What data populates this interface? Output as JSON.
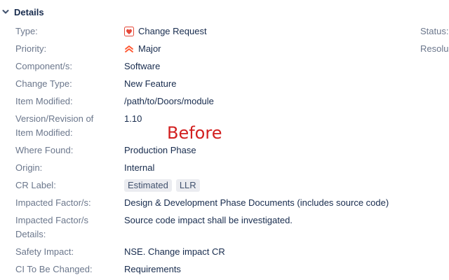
{
  "section": {
    "title": "Details"
  },
  "fields": [
    {
      "label": "Type:",
      "value": "Change Request"
    },
    {
      "label": "Priority:",
      "value": "Major"
    },
    {
      "label": "Component/s:",
      "value": "Software"
    },
    {
      "label": "Change Type:",
      "value": "New Feature"
    },
    {
      "label": "Item Modified:",
      "value": "/path/to/Doors/module"
    },
    {
      "label_line1": "Version/Revision of",
      "label_line2": "Item Modified:",
      "value": "1.10"
    },
    {
      "label": "Where Found:",
      "value": "Production Phase"
    },
    {
      "label": "Origin:",
      "value": "Internal"
    },
    {
      "label": "CR Label:",
      "tags": [
        "Estimated",
        "LLR"
      ]
    },
    {
      "label": "Impacted Factor/s:",
      "value": "Design & Development Phase Documents (includes source code)"
    },
    {
      "label_line1": "Impacted Factor/s",
      "label_line2": "Details:",
      "value": "Source code impact shall be investigated."
    },
    {
      "label": "Safety Impact:",
      "value": "NSE. Change impact CR"
    },
    {
      "label": "CI To Be Changed:",
      "value": "Requirements"
    }
  ],
  "right_column": {
    "status_label": "Status:",
    "resolution_label": "Resolu"
  },
  "overlay_text": "Before",
  "colors": {
    "priority_major": "#ff5630",
    "type_icon": "#e5493a",
    "overlay": "#d21f1f"
  }
}
